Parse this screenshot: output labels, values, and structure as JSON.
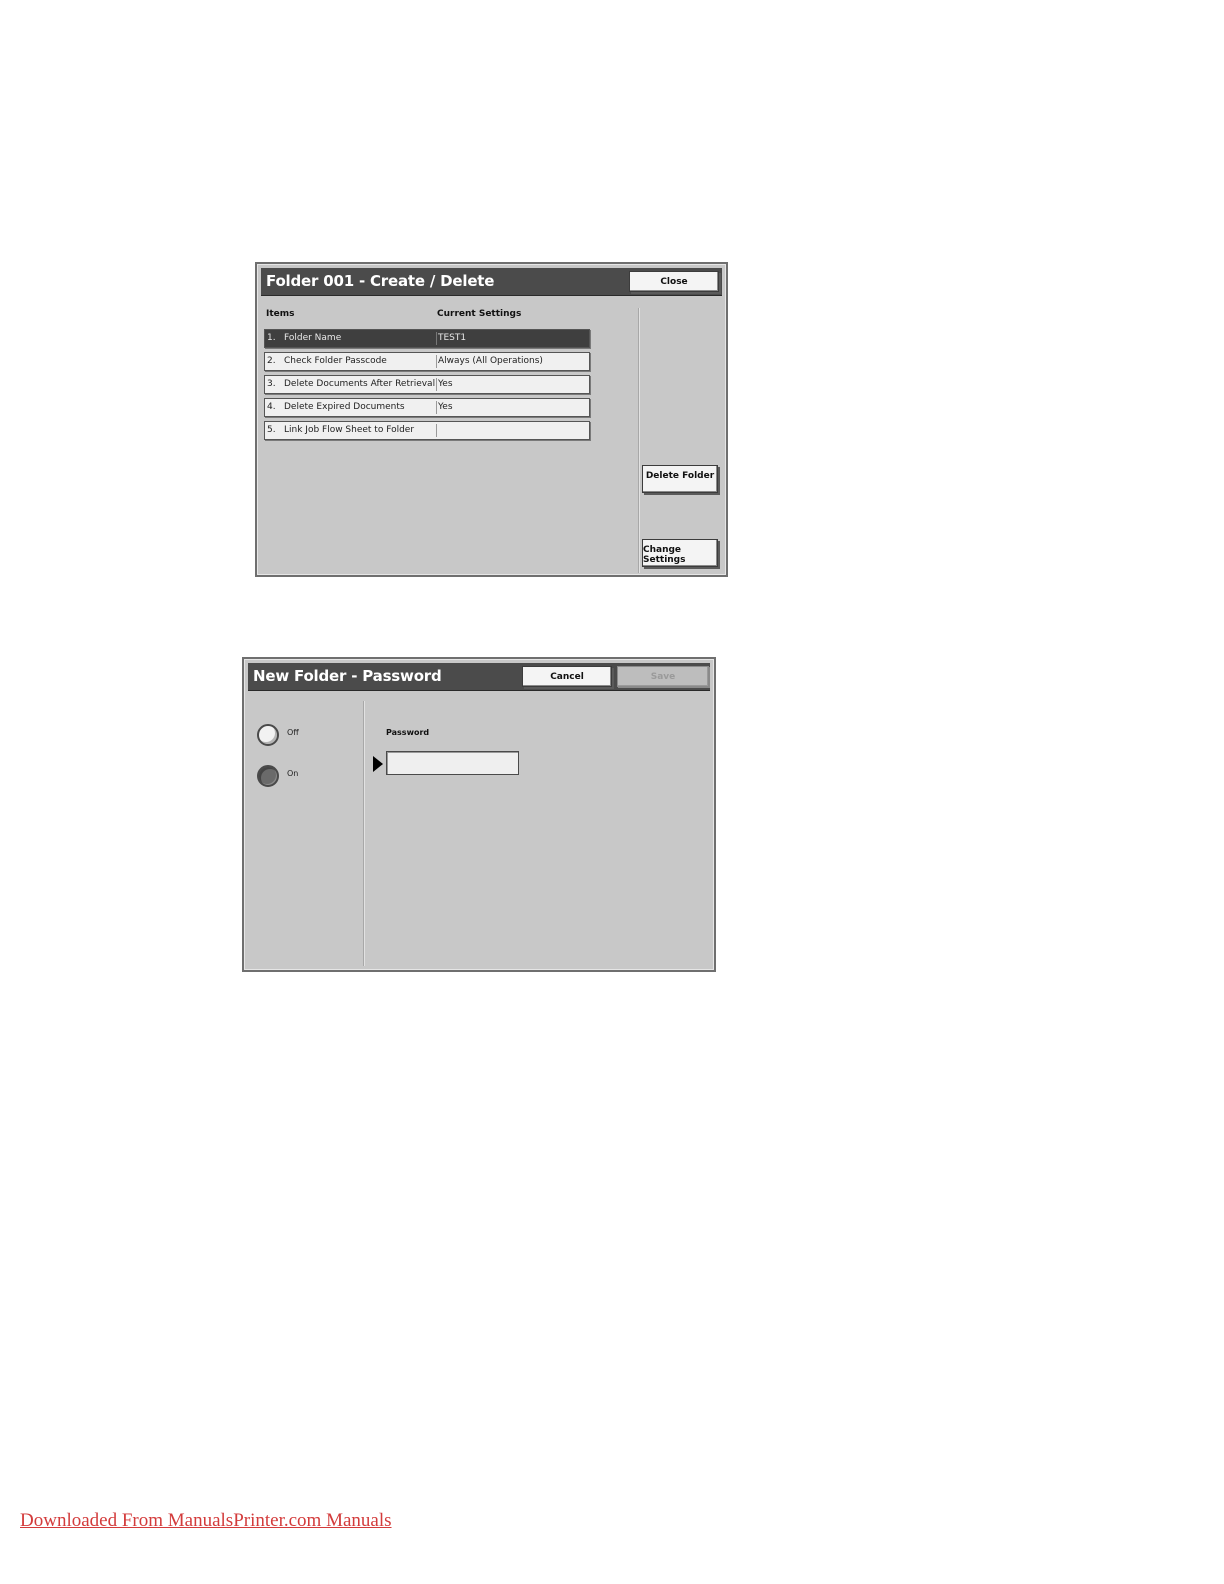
{
  "folder_screen": {
    "title": "Folder   001 - Create / Delete",
    "close_label": "Close",
    "col_items": "Items",
    "col_settings": "Current Settings",
    "rows": [
      {
        "num": "1.",
        "label": "Folder  Name",
        "value": "TEST1",
        "selected": true
      },
      {
        "num": "2.",
        "label": "Check Folder  Passcode",
        "value": "Always (All Operations)",
        "selected": false
      },
      {
        "num": "3.",
        "label": "Delete Documents After Retrieval",
        "value": "Yes",
        "selected": false
      },
      {
        "num": "4.",
        "label": "Delete Expired Documents",
        "value": "Yes",
        "selected": false
      },
      {
        "num": "5.",
        "label": "Link Job Flow Sheet to Folder",
        "value": "",
        "selected": false
      }
    ],
    "delete_folder_label": "Delete Folder",
    "change_settings_label": "Change Settings"
  },
  "password_screen": {
    "title": "New  Folder  - Password",
    "cancel_label": "Cancel",
    "save_label": "Save",
    "off_label": "Off",
    "on_label": "On",
    "selected_option": "On",
    "password_label": "Password",
    "password_value": ""
  },
  "footer": {
    "link_text": "Downloaded From ManualsPrinter.com Manuals",
    "color": "#d33b3b"
  }
}
